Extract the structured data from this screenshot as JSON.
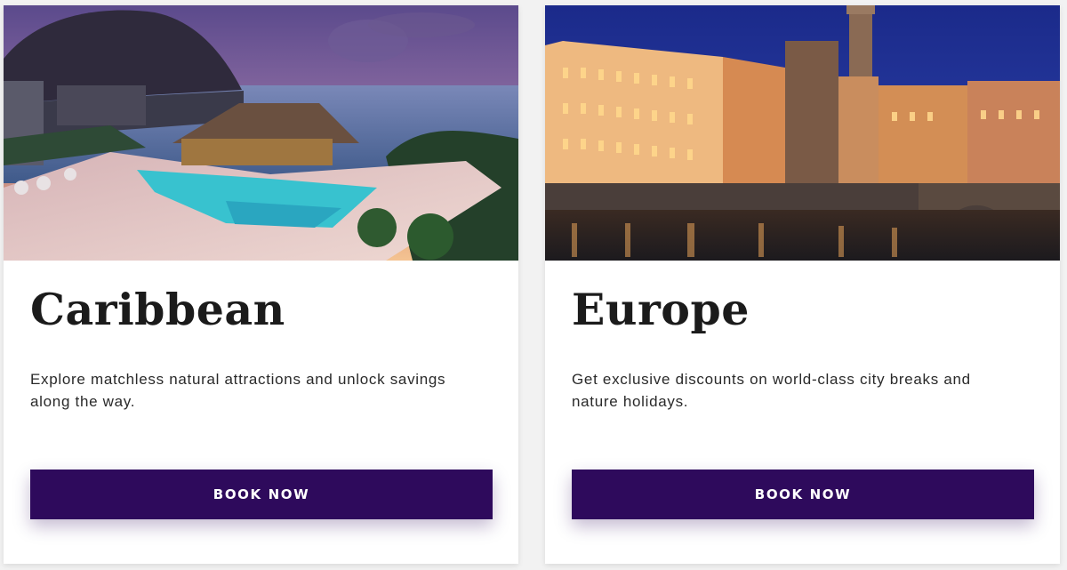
{
  "cards": [
    {
      "title": "Caribbean",
      "description": "Explore matchless natural attractions and unlock savings along the way.",
      "cta_label": "BOOK NOW",
      "image_subject": "resort-pool-sunset"
    },
    {
      "title": "Europe",
      "description": "Get exclusive discounts on world-class city breaks and nature holidays.",
      "cta_label": "BOOK NOW",
      "image_subject": "city-river-night"
    }
  ],
  "colors": {
    "page_background": "#f2f2f2",
    "card_background": "#ffffff",
    "button_background": "#2e0a5c",
    "button_text": "#ffffff",
    "title_text": "#1b1b1b",
    "body_text": "#2a2a2a"
  }
}
